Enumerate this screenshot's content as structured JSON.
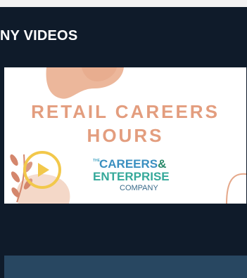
{
  "section": {
    "title": "NY VIDEOS"
  },
  "video": {
    "headline_line1": "RETAIL CAREERS",
    "headline_line2": "HOURS",
    "logo_the": "THE",
    "logo_line1": "CAREERS",
    "logo_amp": "&",
    "logo_line2": "ENTERPRISE",
    "logo_line3": "COMPANY"
  },
  "colors": {
    "background": "#0f1b2a",
    "headline": "#e39d7e",
    "play_accent": "#f2c84b",
    "bottom_bar": "#284761"
  },
  "icons": {
    "play": "play-icon"
  }
}
